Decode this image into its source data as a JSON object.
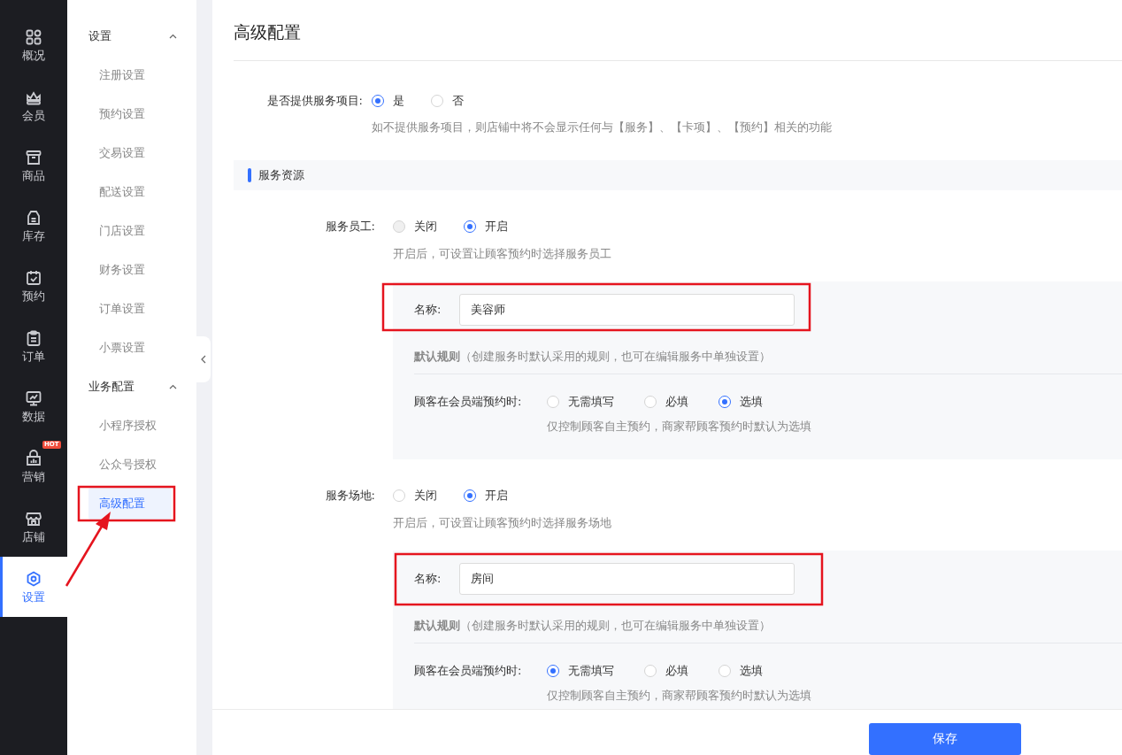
{
  "nav": [
    {
      "label": "概况",
      "selected": false
    },
    {
      "label": "会员",
      "selected": false
    },
    {
      "label": "商品",
      "selected": false
    },
    {
      "label": "库存",
      "selected": false
    },
    {
      "label": "预约",
      "selected": false
    },
    {
      "label": "订单",
      "selected": false
    },
    {
      "label": "数据",
      "selected": false
    },
    {
      "label": "营销",
      "selected": false,
      "badge": "HOT"
    },
    {
      "label": "店铺",
      "selected": false
    },
    {
      "label": "设置",
      "selected": true
    }
  ],
  "submenu": [
    {
      "title": "设置",
      "expanded": true,
      "items": [
        {
          "label": "注册设置",
          "selected": false
        },
        {
          "label": "预约设置",
          "selected": false
        },
        {
          "label": "交易设置",
          "selected": false
        },
        {
          "label": "配送设置",
          "selected": false
        },
        {
          "label": "门店设置",
          "selected": false
        },
        {
          "label": "财务设置",
          "selected": false
        },
        {
          "label": "订单设置",
          "selected": false
        },
        {
          "label": "小票设置",
          "selected": false
        }
      ]
    },
    {
      "title": "业务配置",
      "expanded": true,
      "items": [
        {
          "label": "小程序授权",
          "selected": false
        },
        {
          "label": "公众号授权",
          "selected": false
        },
        {
          "label": "高级配置",
          "selected": true
        }
      ]
    }
  ],
  "page_title": "高级配置",
  "offer_services": {
    "label": "是否提供服务项目:",
    "options": [
      {
        "label": "是",
        "selected": true
      },
      {
        "label": "否",
        "selected": false
      }
    ],
    "hint": "如不提供服务项目，则店铺中将不会显示任何与【服务】、【卡项】、【预约】相关的功能"
  },
  "section_title": "服务资源",
  "resources": [
    {
      "label": "服务员工:",
      "options": [
        {
          "label": "关闭",
          "selected": false,
          "disabled": true
        },
        {
          "label": "开启",
          "selected": true,
          "disabled": false
        }
      ],
      "hint": "开启后，可设置让顾客预约时选择服务员工",
      "name_label": "名称:",
      "name_value": "美容师",
      "rule": "**默认规则**（创建服务时默认采用的规则，也可在编辑服务中单独设置）",
      "booking_label": "顾客在会员端预约时:",
      "booking_options": [
        {
          "label": "无需填写",
          "selected": false
        },
        {
          "label": "必填",
          "selected": false
        },
        {
          "label": "选填",
          "selected": true
        }
      ],
      "booking_hint": "仅控制顾客自主预约，商家帮顾客预约时默认为选填"
    },
    {
      "label": "服务场地:",
      "options": [
        {
          "label": "关闭",
          "selected": false,
          "disabled": false
        },
        {
          "label": "开启",
          "selected": true,
          "disabled": false
        }
      ],
      "hint": "开启后，可设置让顾客预约时选择服务场地",
      "name_label": "名称:",
      "name_value": "房间",
      "rule": "**默认规则**（创建服务时默认采用的规则，也可在编辑服务中单独设置）",
      "booking_label": "顾客在会员端预约时:",
      "booking_options": [
        {
          "label": "无需填写",
          "selected": true
        },
        {
          "label": "必填",
          "selected": false
        },
        {
          "label": "选填",
          "selected": false
        }
      ],
      "booking_hint": "仅控制顾客自主预约，商家帮顾客预约时默认为选填"
    }
  ],
  "save_button": "保存"
}
